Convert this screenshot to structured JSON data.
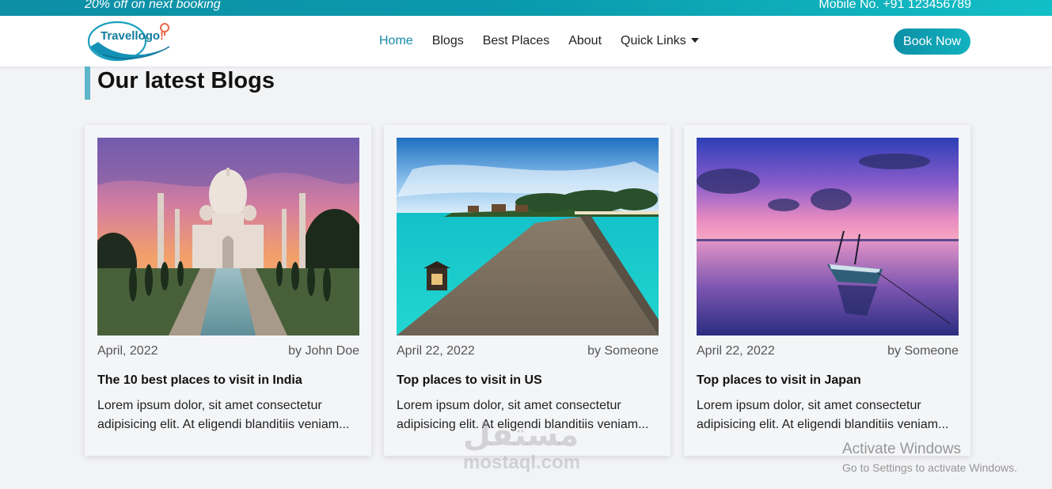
{
  "topbar": {
    "promo": "20% off on next booking",
    "mobile": "Mobile No. +91 123456789"
  },
  "navbar": {
    "logo_text_main": "Travellogo",
    "logo_text_accent": "!",
    "items": [
      {
        "label": "Home",
        "active": true
      },
      {
        "label": "Blogs",
        "active": false
      },
      {
        "label": "Best Places",
        "active": false
      },
      {
        "label": "About",
        "active": false
      },
      {
        "label": "Quick Links",
        "active": false,
        "dropdown": true
      }
    ],
    "cta": "Book Now"
  },
  "section": {
    "title": "Our latest Blogs"
  },
  "cards": [
    {
      "image": "taj-mahal-sunset",
      "date": "April, 2022",
      "author": "by John Doe",
      "title": "The 10 best places to visit in India",
      "excerpt": "Lorem ipsum dolor, sit amet consectetur adipisicing elit. At eligendi blanditiis veniam..."
    },
    {
      "image": "maldives-pier",
      "date": "April 22, 2022",
      "author": "by Someone",
      "title": "Top places to visit in US",
      "excerpt": "Lorem ipsum dolor, sit amet consectetur adipisicing elit. At eligendi blanditiis veniam..."
    },
    {
      "image": "boat-at-dusk",
      "date": "April 22, 2022",
      "author": "by Someone",
      "title": "Top places to visit in Japan",
      "excerpt": "Lorem ipsum dolor, sit amet consectetur adipisicing elit. At eligendi blanditiis veniam..."
    }
  ],
  "watermark": {
    "arabic": "مستقل",
    "latin": "mostaql.com"
  },
  "os_overlay": {
    "line1": "Activate Windows",
    "line2": "Go to Settings to activate Windows."
  },
  "colors": {
    "brand": "#0d8fa6",
    "accent": "#e8674a",
    "title_bar": "#5bb6c8"
  }
}
